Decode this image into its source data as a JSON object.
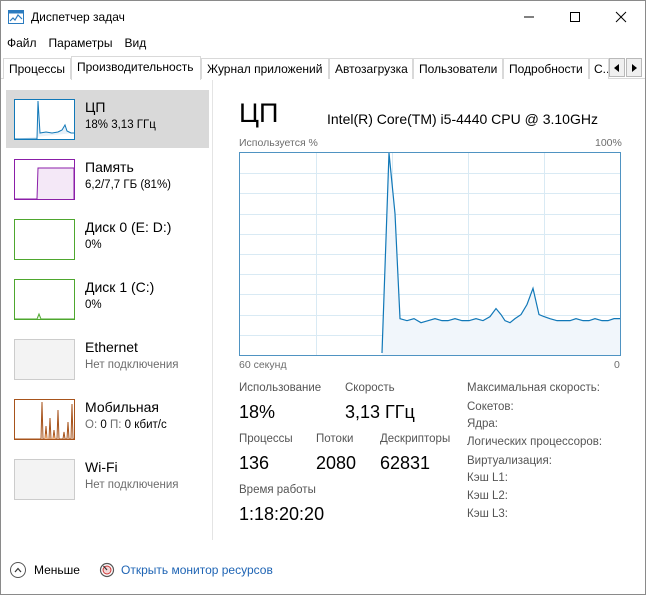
{
  "window": {
    "title": "Диспетчер задач"
  },
  "menu": [
    "Файл",
    "Параметры",
    "Вид"
  ],
  "tabs": [
    {
      "label": "Процессы"
    },
    {
      "label": "Производительность"
    },
    {
      "label": "Журнал приложений"
    },
    {
      "label": "Автозагрузка"
    },
    {
      "label": "Пользователи"
    },
    {
      "label": "Подробности"
    },
    {
      "label": "С..."
    }
  ],
  "sidebar": {
    "items": [
      {
        "title": "ЦП",
        "sub": "18% 3,13 ГГц",
        "color": "#1178b8"
      },
      {
        "title": "Память",
        "sub": "6,2/7,7 ГБ (81%)",
        "color": "#8b1ea8"
      },
      {
        "title": "Диск 0 (E: D:)",
        "sub": "0%",
        "color": "#4ea72e"
      },
      {
        "title": "Диск 1 (C:)",
        "sub": "0%",
        "color": "#4ea72e"
      },
      {
        "title": "Ethernet",
        "sub": "Нет подключения",
        "color": "#cccccc"
      },
      {
        "title": "Мобильная",
        "sub_prefix_o": "О:",
        "sub_o": "0",
        "sub_prefix_p": "П:",
        "sub_p": "0 кбит/с",
        "color": "#a7531b"
      },
      {
        "title": "Wi-Fi",
        "sub": "Нет подключения",
        "color": "#cccccc"
      }
    ]
  },
  "main": {
    "title": "ЦП",
    "cpu_name": "Intel(R) Core(TM) i5-4440 CPU @ 3.10GHz",
    "graph": {
      "top_left": "Используется %",
      "top_right": "100%",
      "bottom_left": "60 секунд",
      "bottom_right": "0",
      "color": "#1178b8",
      "fill": "#f1f6fb",
      "grid_color": "#d9eaf4"
    },
    "stats": {
      "usage_label": "Использование",
      "usage_value": "18%",
      "speed_label": "Скорость",
      "speed_value": "3,13 ГГц",
      "processes_label": "Процессы",
      "processes_value": "136",
      "threads_label": "Потоки",
      "threads_value": "2080",
      "handles_label": "Дескрипторы",
      "handles_value": "62831",
      "uptime_label": "Время работы",
      "uptime_value": "1:18:20:20"
    },
    "info": [
      "Максимальная скорость:",
      "Сокетов:",
      "Ядра:",
      "Логических процессоров:",
      "Виртуализация:",
      "Кэш L1:",
      "Кэш L2:",
      "Кэш L3:"
    ]
  },
  "footer": {
    "fewer_label": "Меньше",
    "monitor_label": "Открыть монитор ресурсов"
  }
}
